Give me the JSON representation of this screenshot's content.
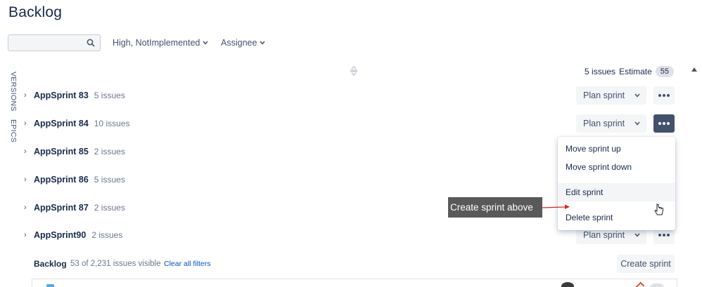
{
  "page": {
    "title": "Backlog"
  },
  "toolbar": {
    "search_value": "",
    "search_placeholder": "",
    "filter_label": "High, NotImplemented",
    "assignee_label": "Assignee"
  },
  "side_tabs": {
    "versions": "VERSIONS",
    "epics": "EPICS"
  },
  "header": {
    "issues_label": "5 issues",
    "estimate_label": "Estimate",
    "estimate_value": "55"
  },
  "sprints": [
    {
      "name": "AppSprint 83",
      "count": "5 issues",
      "plan_label": "Plan sprint"
    },
    {
      "name": "AppSprint 84",
      "count": "10 issues",
      "plan_label": "Plan sprint"
    },
    {
      "name": "AppSprint 85",
      "count": "2 issues"
    },
    {
      "name": "AppSprint 86",
      "count": "5 issues"
    },
    {
      "name": "AppSprint 87",
      "count": "2 issues"
    },
    {
      "name": "AppSprint90",
      "count": "2 issues",
      "plan_label": "Plan sprint"
    }
  ],
  "dropdown": {
    "items": [
      "Move sprint up",
      "Move sprint down",
      "Edit sprint",
      "Delete sprint"
    ]
  },
  "tooltip": {
    "text": "Create sprint above"
  },
  "backlog": {
    "label": "Backlog",
    "count": "53 of 2,231 issues visible",
    "clear_filters": "Clear all filters",
    "create_sprint": "Create sprint"
  },
  "colors": {
    "text_primary": "#172b4d",
    "text_secondary": "#6b778c",
    "link": "#0052cc",
    "active_button": "#42526e",
    "tooltip_bg": "#595959",
    "annotation_arrow": "#e02020"
  }
}
